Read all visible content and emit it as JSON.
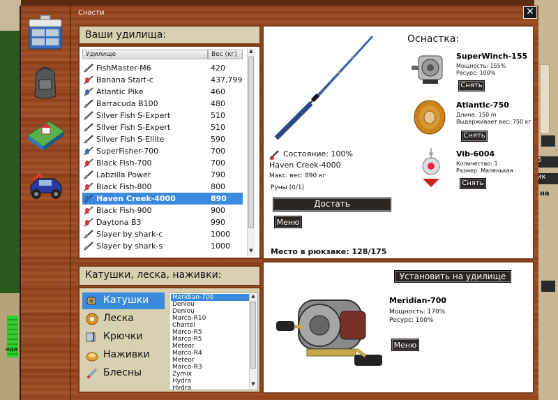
{
  "window": {
    "title": "Снасти",
    "close_label": "✕"
  },
  "rods": {
    "heading": "Ваши удилища:",
    "col_rod": "Удилище",
    "col_weight": "Вес (кг)",
    "items": [
      {
        "name": "FishMaster-M6",
        "weight": "420",
        "icon": "rod-icon"
      },
      {
        "name": "Banana Start-c",
        "weight": "437,799",
        "icon": "float-icon"
      },
      {
        "name": "Atlantic Pike",
        "weight": "460",
        "icon": "spinner-icon"
      },
      {
        "name": "Barracuda B100",
        "weight": "480",
        "icon": "rod-icon"
      },
      {
        "name": "Silver Fish S-Expert",
        "weight": "510",
        "icon": "rod-icon"
      },
      {
        "name": "Silver Fish S-Expert",
        "weight": "510",
        "icon": "rod-icon"
      },
      {
        "name": "Silver Fish S-Ellite",
        "weight": "590",
        "icon": "rod-icon"
      },
      {
        "name": "SuperFisher-700",
        "weight": "700",
        "icon": "spinner-icon"
      },
      {
        "name": "Black Fish-700",
        "weight": "700",
        "icon": "float-icon"
      },
      {
        "name": "Labzilla Power",
        "weight": "790",
        "icon": "rod-icon"
      },
      {
        "name": "Black Fish-800",
        "weight": "800",
        "icon": "float-icon"
      },
      {
        "name": "Haven Creek-4000",
        "weight": "890",
        "icon": "spinner-icon"
      },
      {
        "name": "Black Fish-900",
        "weight": "900",
        "icon": "float-icon"
      },
      {
        "name": "Daytona B3",
        "weight": "990",
        "icon": "float-icon"
      },
      {
        "name": "Slayer by shark-c",
        "weight": "1000",
        "icon": "rod-icon"
      },
      {
        "name": "Slayer by shark-s",
        "weight": "1000",
        "icon": "rod-icon"
      }
    ],
    "selected_index": 11
  },
  "rod_detail": {
    "condition": "Состояние: 100%",
    "name": "Haven Creek-4000",
    "max_weight": "Макс. вес: 890 кг",
    "runes": "Руны (0/1)",
    "get_button": "Достать",
    "menu_button": "Меню",
    "backpack": "Место в рюкзаке: 128/175",
    "tackle_heading": "Оснастка:",
    "tackle": [
      {
        "name": "SuperWinch-155",
        "line1": "Мощность: 155%",
        "line2": "Ресурс: 100%",
        "button": "Снять"
      },
      {
        "name": "Atlantic-750",
        "line1": "Длина: 150 m",
        "line2": "Выдерживает вес: 750 кг",
        "button": "Снять"
      },
      {
        "name": "Vib-6004",
        "line1": "Количество: 1",
        "line2": "Размер: Маленькая",
        "button": "Снять"
      }
    ]
  },
  "reels": {
    "heading": "Катушки, леска, наживки:",
    "categories": [
      {
        "label": "Катушки",
        "icon": "reel-icon"
      },
      {
        "label": "Леска",
        "icon": "line-icon"
      },
      {
        "label": "Крючки",
        "icon": "hook-icon"
      },
      {
        "label": "Наживки",
        "icon": "bait-icon"
      },
      {
        "label": "Блесны",
        "icon": "lure-icon"
      }
    ],
    "selected_category": 0,
    "items": [
      "Meridian-700",
      "Denlou",
      "Denlou",
      "Marco-R10",
      "Chartel",
      "Marco-R5",
      "Marco-R5",
      "Meteor",
      "Marco-R4",
      "Meteor",
      "Marco-R3",
      "Zymix",
      "Hydra",
      "Hydra"
    ],
    "selected_item": 0
  },
  "reel_detail": {
    "install_button": "Установить на удилище",
    "name": "Meridian-700",
    "power": "Мощность: 170%",
    "resource": "Ресурс: 100%",
    "menu_button": "Меню"
  },
  "background": {
    "label_left": "еда",
    "label_right_1": "5",
    "label_right_2": "ик",
    "label_right_3": "на"
  },
  "colors": {
    "selection": "#3a8ae0",
    "wood": "#9b4a20",
    "panel": "#d8d0b0",
    "button": "#2b2624"
  }
}
